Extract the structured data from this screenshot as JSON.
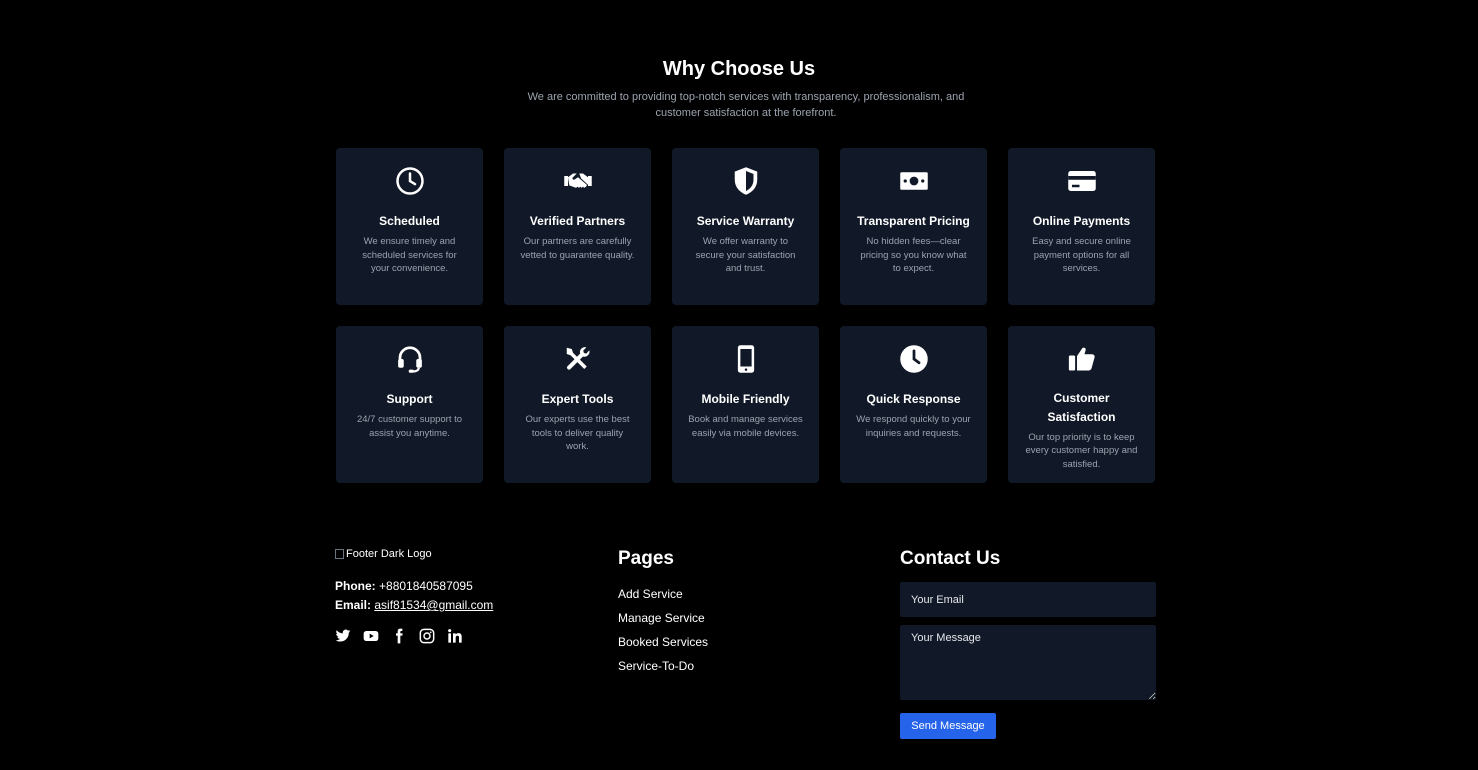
{
  "section": {
    "title": "Why Choose Us",
    "subtitle": "We are committed to providing top-notch services with transparency, professionalism, and customer satisfaction at the forefront."
  },
  "features": [
    {
      "icon": "clock-icon",
      "title": "Scheduled",
      "desc": "We ensure timely and scheduled services for your convenience."
    },
    {
      "icon": "handshake-icon",
      "title": "Verified Partners",
      "desc": "Our partners are carefully vetted to guarantee quality."
    },
    {
      "icon": "shield-icon",
      "title": "Service Warranty",
      "desc": "We offer warranty to secure your satisfaction and trust."
    },
    {
      "icon": "money-bill-icon",
      "title": "Transparent Pricing",
      "desc": "No hidden fees—clear pricing so you know what to expect."
    },
    {
      "icon": "credit-card-icon",
      "title": "Online Payments",
      "desc": "Easy and secure online payment options for all services."
    },
    {
      "icon": "headset-icon",
      "title": "Support",
      "desc": "24/7 customer support to assist you anytime."
    },
    {
      "icon": "tools-icon",
      "title": "Expert Tools",
      "desc": "Our experts use the best tools to deliver quality work."
    },
    {
      "icon": "mobile-icon",
      "title": "Mobile Friendly",
      "desc": "Book and manage services easily via mobile devices."
    },
    {
      "icon": "clock-filled-icon",
      "title": "Quick Response",
      "desc": "We respond quickly to your inquiries and requests."
    },
    {
      "icon": "thumbs-up-icon",
      "title": "Customer Satisfaction",
      "desc": "Our top priority is to keep every customer happy and satisfied."
    }
  ],
  "footer": {
    "logo_alt": "Footer Dark Logo",
    "phone_label": "Phone:",
    "phone": "+8801840587095",
    "email_label": "Email:",
    "email": "asif81534@gmail.com",
    "socials": [
      "twitter-icon",
      "youtube-icon",
      "facebook-icon",
      "instagram-icon",
      "linkedin-icon"
    ],
    "pages_title": "Pages",
    "pages": [
      "Add Service",
      "Manage Service",
      "Booked Services",
      "Service-To-Do"
    ],
    "contact_title": "Contact Us",
    "email_placeholder": "Your Email",
    "message_placeholder": "Your Message",
    "send_label": "Send Message"
  },
  "colors": {
    "background": "#000000",
    "card": "#111827",
    "muted_text": "#9ca3af",
    "button": "#2563eb"
  }
}
